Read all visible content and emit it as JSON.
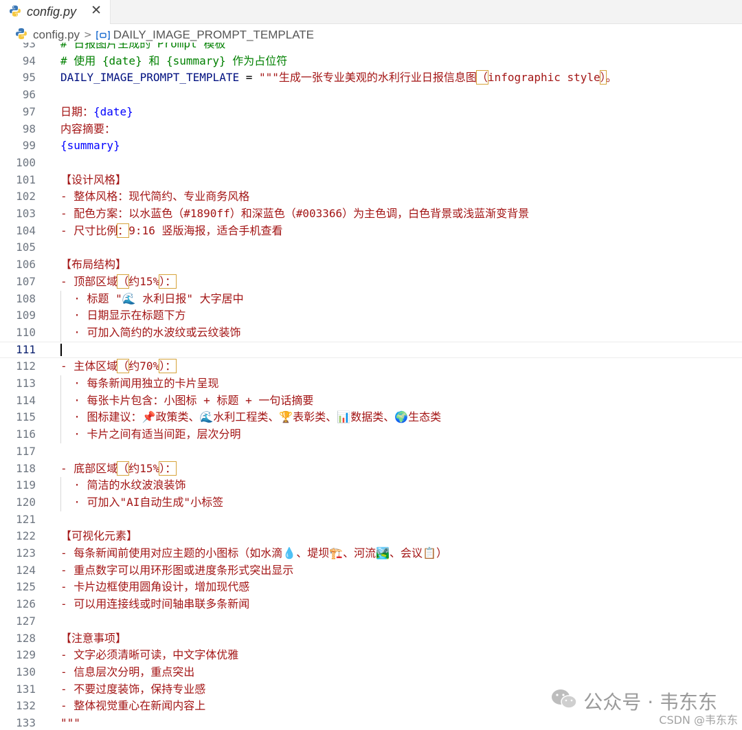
{
  "tab": {
    "label": "config.py",
    "close": "✕"
  },
  "breadcrumb": {
    "file": "config.py",
    "separator": ">",
    "symbol": "DAILY_IMAGE_PROMPT_TEMPLATE"
  },
  "editor": {
    "lines": [
      {
        "n": "93",
        "t": "# 日报图片生成的 Prompt 模板",
        "cls": "cmt"
      },
      {
        "n": "94",
        "t": "# 使用 {date} 和 {summary} 作为占位符",
        "cls": "cmt"
      },
      {
        "n": "95",
        "segs": [
          {
            "t": "DAILY_IMAGE_PROMPT_TEMPLATE",
            "c": "var"
          },
          {
            "t": " = ",
            "c": "op"
          },
          {
            "t": "\"\"\"生成一张专业美观的水利行业日报信息图",
            "c": ""
          },
          {
            "t": "（",
            "c": "",
            "box": true
          },
          {
            "t": "infographic style",
            "c": ""
          },
          {
            "t": "）",
            "c": "",
            "box": true
          },
          {
            "t": "。",
            "c": ""
          }
        ]
      },
      {
        "n": "96",
        "t": ""
      },
      {
        "n": "97",
        "segs": [
          {
            "t": "日期：",
            "c": ""
          },
          {
            "t": "{date}",
            "c": "ph"
          }
        ]
      },
      {
        "n": "98",
        "t": "内容摘要："
      },
      {
        "n": "99",
        "segs": [
          {
            "t": "{summary}",
            "c": "ph"
          }
        ]
      },
      {
        "n": "100",
        "t": ""
      },
      {
        "n": "101",
        "t": "【设计风格】"
      },
      {
        "n": "102",
        "t": "- 整体风格：现代简约、专业商务风格"
      },
      {
        "n": "103",
        "t": "- 配色方案：以水蓝色（#1890ff）和深蓝色（#003366）为主色调，白色背景或浅蓝渐变背景"
      },
      {
        "n": "104",
        "segs": [
          {
            "t": "- 尺寸比例",
            "c": ""
          },
          {
            "t": "：",
            "c": "",
            "box": true
          },
          {
            "t": "9:16 竖版海报，适合手机查看",
            "c": ""
          }
        ]
      },
      {
        "n": "105",
        "t": ""
      },
      {
        "n": "106",
        "t": "【布局结构】"
      },
      {
        "n": "107",
        "segs": [
          {
            "t": "- 顶部区域",
            "c": ""
          },
          {
            "t": "（",
            "c": "",
            "box": true
          },
          {
            "t": "约15%",
            "c": ""
          },
          {
            "t": "）：",
            "c": "",
            "box": true
          }
        ]
      },
      {
        "n": "108",
        "t": "  · 标题 \"🌊 水利日报\" 大字居中"
      },
      {
        "n": "109",
        "t": "  · 日期显示在标题下方"
      },
      {
        "n": "110",
        "t": "  · 可加入简约的水波纹或云纹装饰"
      },
      {
        "n": "111",
        "t": "",
        "active": true
      },
      {
        "n": "112",
        "segs": [
          {
            "t": "- 主体区域",
            "c": ""
          },
          {
            "t": "（",
            "c": "",
            "box": true
          },
          {
            "t": "约70%",
            "c": ""
          },
          {
            "t": "）：",
            "c": "",
            "box": true
          }
        ]
      },
      {
        "n": "113",
        "t": "  · 每条新闻用独立的卡片呈现"
      },
      {
        "n": "114",
        "t": "  · 每张卡片包含：小图标 + 标题 + 一句话摘要"
      },
      {
        "n": "115",
        "t": "  · 图标建议：📌政策类、🌊水利工程类、🏆表彰类、📊数据类、🌍生态类"
      },
      {
        "n": "116",
        "t": "  · 卡片之间有适当间距，层次分明"
      },
      {
        "n": "117",
        "t": ""
      },
      {
        "n": "118",
        "segs": [
          {
            "t": "- 底部区域",
            "c": ""
          },
          {
            "t": "（",
            "c": "",
            "box": true
          },
          {
            "t": "约15%",
            "c": ""
          },
          {
            "t": "）：",
            "c": "",
            "box": true
          }
        ]
      },
      {
        "n": "119",
        "t": "  · 简洁的水纹波浪装饰"
      },
      {
        "n": "120",
        "t": "  · 可加入\"AI自动生成\"小标签"
      },
      {
        "n": "121",
        "t": ""
      },
      {
        "n": "122",
        "t": "【可视化元素】"
      },
      {
        "n": "123",
        "t": "- 每条新闻前使用对应主题的小图标（如水滴💧、堤坝🏗️、河流🏞️、会议📋）"
      },
      {
        "n": "124",
        "t": "- 重点数字可以用环形图或进度条形式突出显示"
      },
      {
        "n": "125",
        "t": "- 卡片边框使用圆角设计，增加现代感"
      },
      {
        "n": "126",
        "t": "- 可以用连接线或时间轴串联多条新闻"
      },
      {
        "n": "127",
        "t": ""
      },
      {
        "n": "128",
        "t": "【注意事项】"
      },
      {
        "n": "129",
        "t": "- 文字必须清晰可读，中文字体优雅"
      },
      {
        "n": "130",
        "t": "- 信息层次分明，重点突出"
      },
      {
        "n": "131",
        "t": "- 不要过度装饰，保持专业感"
      },
      {
        "n": "132",
        "t": "- 整体视觉重心在新闻内容上"
      },
      {
        "n": "133",
        "t": "\"\"\""
      }
    ]
  },
  "watermark": {
    "text": "公众号 · 韦东东",
    "csdn": "CSDN @韦东东"
  },
  "colors": {
    "string": "#a31515",
    "comment": "#008000",
    "placeholder": "#0000ff",
    "variable": "#001080"
  }
}
